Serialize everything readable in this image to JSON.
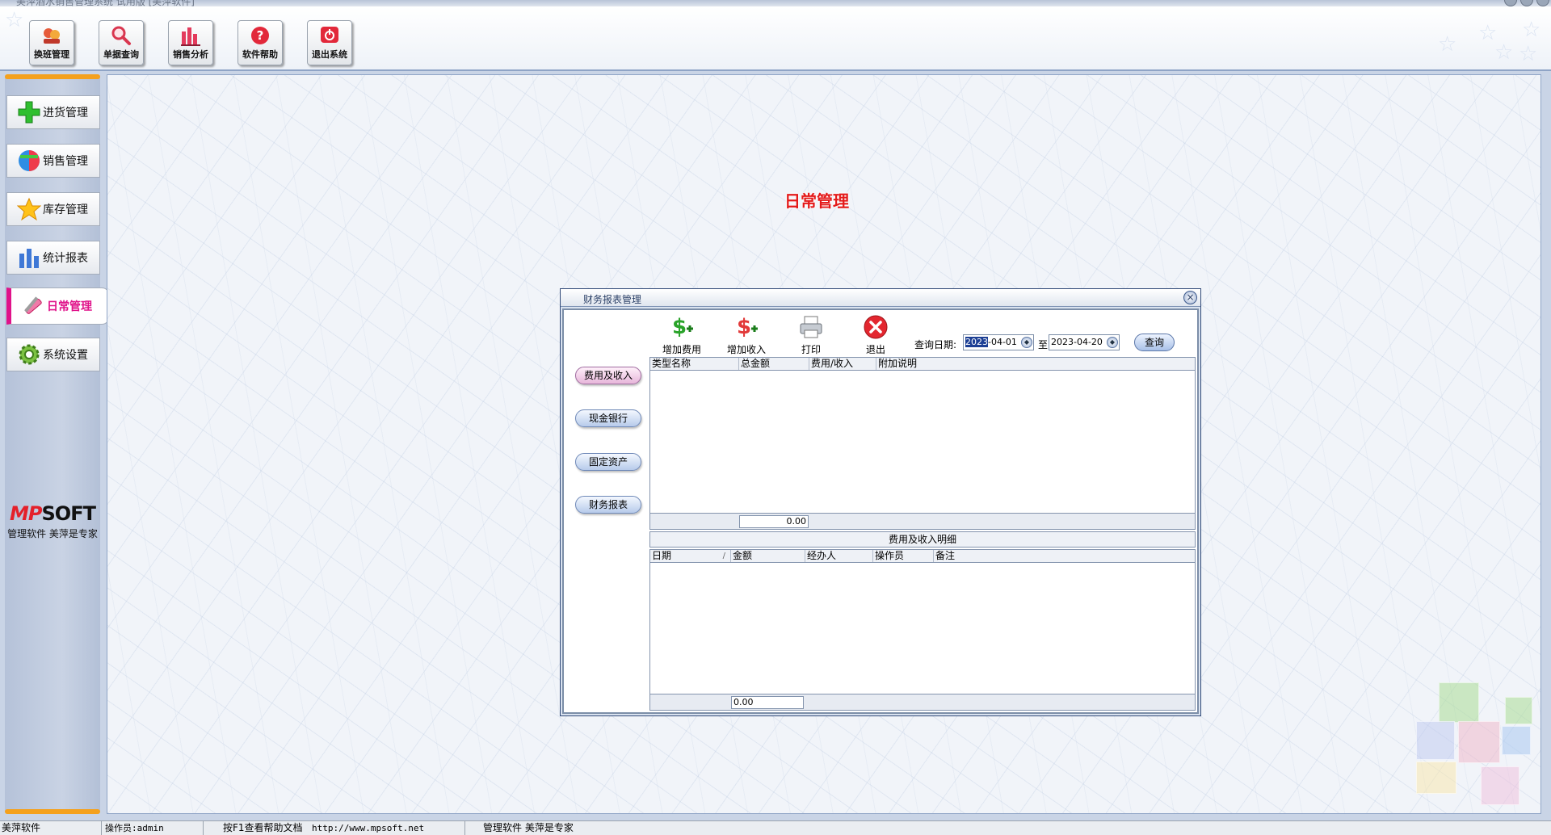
{
  "app": {
    "title": "美萍酒水销售管理系统 试用版 [美萍软件]"
  },
  "toolbar": {
    "buttons": [
      {
        "label": "换班管理",
        "icon": "shift-icon"
      },
      {
        "label": "单据查询",
        "icon": "magnifier-icon"
      },
      {
        "label": "销售分析",
        "icon": "bar-chart-icon"
      },
      {
        "label": "软件帮助",
        "icon": "help-icon"
      },
      {
        "label": "退出系统",
        "icon": "power-icon"
      }
    ]
  },
  "sidebar": {
    "items": [
      {
        "label": "进货管理",
        "icon": "plus-icon"
      },
      {
        "label": "销售管理",
        "icon": "globe-icon"
      },
      {
        "label": "库存管理",
        "icon": "star-icon"
      },
      {
        "label": "统计报表",
        "icon": "bar-chart-icon"
      },
      {
        "label": "日常管理",
        "icon": "tools-icon",
        "active": true
      },
      {
        "label": "系统设置",
        "icon": "gear-icon"
      }
    ],
    "brand": {
      "logo_a": "MP",
      "logo_b": "SOFT",
      "slogan": "管理软件 美萍是专家"
    }
  },
  "main": {
    "section_title": "日常管理"
  },
  "dialog": {
    "title": "财务报表管理",
    "actions": [
      {
        "label": "增加费用",
        "icon": "money-add-icon"
      },
      {
        "label": "增加收入",
        "icon": "money-income-icon"
      },
      {
        "label": "打印",
        "icon": "printer-icon"
      },
      {
        "label": "退出",
        "icon": "close-red-icon"
      }
    ],
    "query": {
      "label": "查询日期:",
      "start_highlight": "2023",
      "start_rest": "-04-01",
      "to_label": "至",
      "end": "2023-04-20",
      "button": "查询"
    },
    "side_buttons": [
      "费用及收入",
      "现金银行",
      "固定资产",
      "财务报表"
    ],
    "summary_grid": {
      "columns": [
        "类型名称",
        "总金额",
        "费用/收入",
        "附加说明"
      ],
      "rows": [],
      "total": "0.00"
    },
    "detail_title": "费用及收入明细",
    "detail_grid": {
      "columns": [
        "日期",
        "金额",
        "经办人",
        "操作员",
        "备注"
      ],
      "sort_mark": "/",
      "rows": [],
      "total": "0.00"
    }
  },
  "statusbar": {
    "company": "美萍软件",
    "operator": "操作员:admin",
    "help": "按F1查看帮助文档",
    "url": "http://www.mpsoft.net",
    "slogan": "管理软件 美萍是专家"
  },
  "colors": {
    "accent_orange": "#f4a11e",
    "active_pink": "#e0128a",
    "title_red": "#e41a1a",
    "highlight_blue": "#1c3f94"
  }
}
